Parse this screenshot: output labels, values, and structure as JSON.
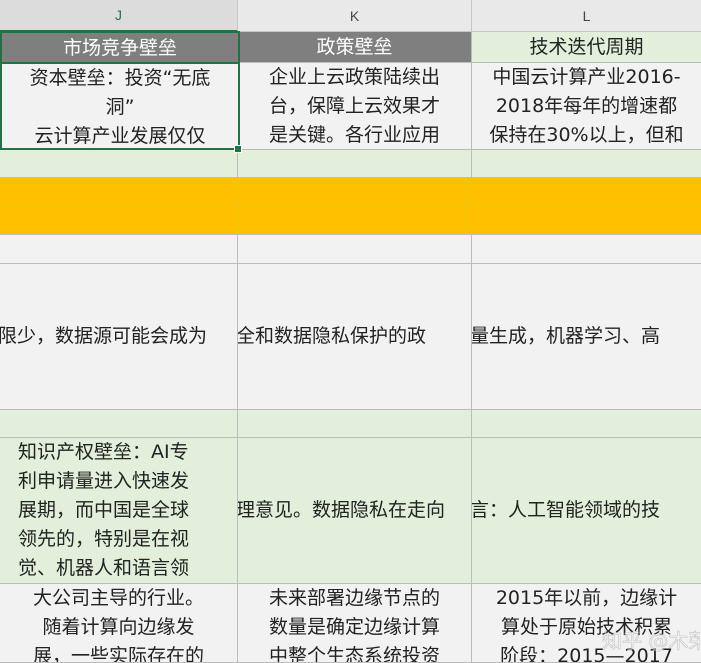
{
  "columns": [
    {
      "letter": "J"
    },
    {
      "letter": "K"
    },
    {
      "letter": "L"
    }
  ],
  "colors": {
    "header_dark": "#7f7f7f",
    "header_light": "#e2efda",
    "light_green": "#e2efda",
    "orange": "#ffc000",
    "plain": "#f2f2f2",
    "selection": "#217346"
  },
  "rows": {
    "header": [
      "市场竞争壁垒",
      "政策壁垒",
      "技术迭代周期"
    ],
    "r1": [
      "资本壁垒：投资“无底\n洞”\n云计算产业发展仅仅",
      "企业上云政策陆续出\n台，保障上云效果才\n是关键。各行业应用",
      "中国云计算产业2016-\n2018年每年的增速都\n保持在30%以上，但和"
    ],
    "r6": [
      "限少，数据源可能会成为",
      "全和数据隐私保护的政",
      "量生成，机器学习、高"
    ],
    "r8_col_j": "知识产权壁垒：AI专\n利申请量进入快速发\n展期，而中国是全球\n领先的，特别是在视\n觉、机器人和语言领",
    "r8_col_k": "理意见。数据隐私在走向",
    "r8_col_l": "言：人工智能领域的技",
    "r9": [
      "大公司主导的行业。\n随着计算向边缘发\n展，一些实际存在的",
      "未来部署边缘节点的\n数量是确定边缘计算\n中整个生态系统投资",
      "2015年以前，边缘计\n算处于原始技术积累\n阶段：2015—2017"
    ]
  },
  "watermark": "知乎 @木荣"
}
